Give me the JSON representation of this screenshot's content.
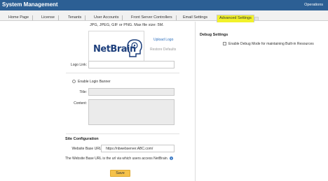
{
  "header": {
    "title": "System Management",
    "operations": "Operations"
  },
  "tabs": [
    {
      "label": "Home Page"
    },
    {
      "label": "License"
    },
    {
      "label": "Tenants"
    },
    {
      "label": "User Accounts"
    },
    {
      "label": "Front Server Controllers"
    },
    {
      "label": "Email Settings"
    },
    {
      "label": "Advanced Settings",
      "active": true
    }
  ],
  "logo_section": {
    "file_note": "JPG, JPEG, GIF or PNG. Max file size: 5M.",
    "logo_text": "NetBrain",
    "upload_logo": "Upload Logo",
    "restore_defaults": "Restore Defaults",
    "logo_link_label": "Logo Link:",
    "logo_link_value": ""
  },
  "login_banner": {
    "enable_label": "Enable Login Banner",
    "title_label": "Title:",
    "content_label": "Content:"
  },
  "site_configuration": {
    "heading": "Site Configuration",
    "website_base_url_label": "Website Base URL:",
    "website_base_url_value": "https://nbwebserver.ABC.com/",
    "description": "The Website Base URL is the url via which users access NetBrain.",
    "save_label": "Save"
  },
  "debug_settings": {
    "heading": "Debug Settings",
    "enable_debug_label": "Enable Debug Mode for maintaining Built-in Resources"
  },
  "colors": {
    "header_bg": "#2c5f94",
    "highlight": "#f2f22a",
    "save_button": "#f5c24a",
    "link": "#2a6ebd"
  }
}
